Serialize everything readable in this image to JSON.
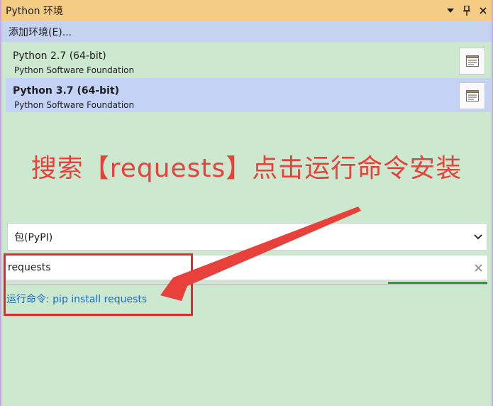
{
  "titlebar": {
    "title": "Python 环境",
    "dropdown_icon": "triangle-down-icon",
    "pin_icon": "pin-icon",
    "close_icon": "close-icon"
  },
  "add_env": {
    "label": "添加环境(E)..."
  },
  "environments": [
    {
      "name": "Python 2.7 (64-bit)",
      "publisher": "Python Software Foundation",
      "selected": false,
      "icon": "console-icon"
    },
    {
      "name": "Python 3.7 (64-bit)",
      "publisher": "Python Software Foundation",
      "selected": true,
      "icon": "console-icon"
    }
  ],
  "annotation": {
    "text": "搜索【requests】点击运行命令安装",
    "color": "#e8413b"
  },
  "package_source": {
    "selected": "包(PyPI)"
  },
  "search": {
    "value": "requests"
  },
  "command": {
    "label": "运行命令: pip install requests"
  },
  "colors": {
    "background": "#cce8cf",
    "titlebar": "#f5cc84",
    "selection": "#c3d2f5",
    "link": "#1a69c4",
    "progress": "#16a82a",
    "highlight": "#e32a2a"
  }
}
